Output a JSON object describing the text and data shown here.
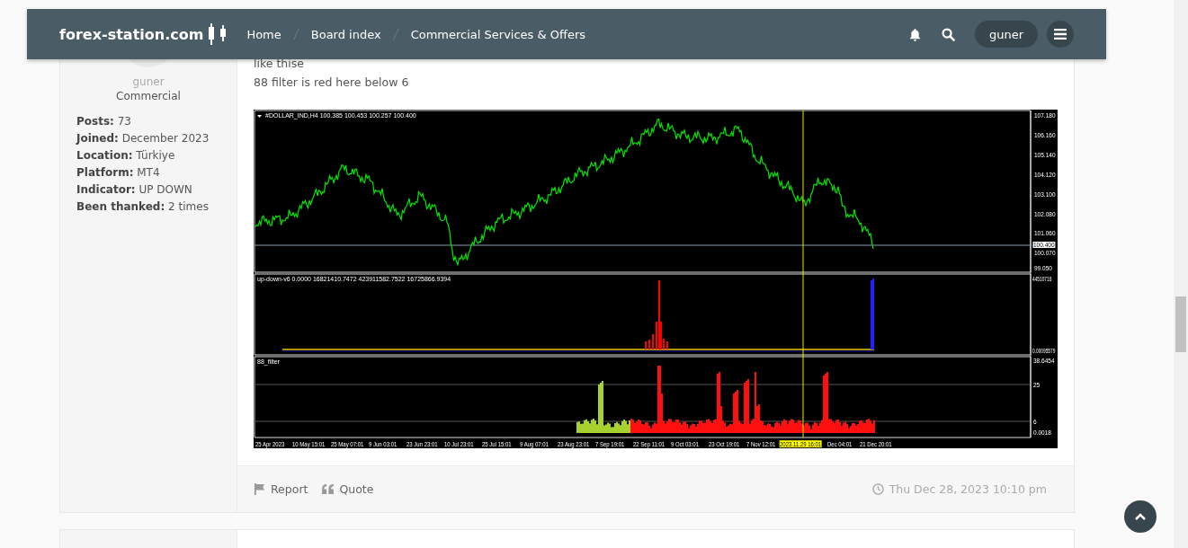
{
  "header": {
    "logo": "forex-station.com",
    "nav": [
      "Home",
      "Board index",
      "Commercial Services & Offers"
    ],
    "user": "guner"
  },
  "post": {
    "author": "guner",
    "rank": "Commercial",
    "stats": [
      "**Posts:** 73",
      "**Joined:** December 2023",
      "**Location:** Türkiye",
      "**Platform:** MT4",
      "**Indicator:** UP DOWN",
      "**Been thanked:** 2 times"
    ],
    "lines": [
      "like thise",
      "88 filter is red here below 6"
    ],
    "chart": {
      "symbol_line": "#DOLLAR_IND,H4  100.385 100.453 100.257 100.400",
      "indicator_line": "up-down-v6 0.0000 16821410.7472 423911582.7522 16725866.9394",
      "filter_label": "88_filter",
      "price_axis": [
        "107.180",
        "106.160",
        "105.140",
        "104.120",
        "103.100",
        "102.080",
        "101.060",
        "100.070",
        "99.050"
      ],
      "current_price": "100.400",
      "indicator_axis": [
        "44510716",
        "0.00095579"
      ],
      "filter_axis": [
        "38.6454",
        "25",
        "6",
        "0.0018"
      ],
      "time_axis": [
        {
          "label": "25 Apr 2023",
          "selected": false
        },
        {
          "label": "10 May 15:01",
          "selected": false
        },
        {
          "label": "25 May 07:01",
          "selected": false
        },
        {
          "label": "9 Jun 03:01",
          "selected": false
        },
        {
          "label": "23 Jun 23:01",
          "selected": false
        },
        {
          "label": "10 Jul 23:01",
          "selected": false
        },
        {
          "label": "25 Jul 15:01",
          "selected": false
        },
        {
          "label": "9 Aug 07:01",
          "selected": false
        },
        {
          "label": "23 Aug 23:01",
          "selected": false
        },
        {
          "label": "7 Sep 19:01",
          "selected": false
        },
        {
          "label": "22 Sep 11:01",
          "selected": false
        },
        {
          "label": "9 Oct 03:01",
          "selected": false
        },
        {
          "label": "23 Oct 19:01",
          "selected": false
        },
        {
          "label": "7 Nov 12:01",
          "selected": false
        },
        {
          "label": "2023.11.29 16:01",
          "selected": true
        },
        {
          "label": "Dec 04:01",
          "selected": false
        },
        {
          "label": "21 Dec 20:01",
          "selected": false
        }
      ]
    },
    "actions": [
      "Report",
      "Quote"
    ],
    "date": "Thu Dec 28, 2023 10:10 pm"
  }
}
